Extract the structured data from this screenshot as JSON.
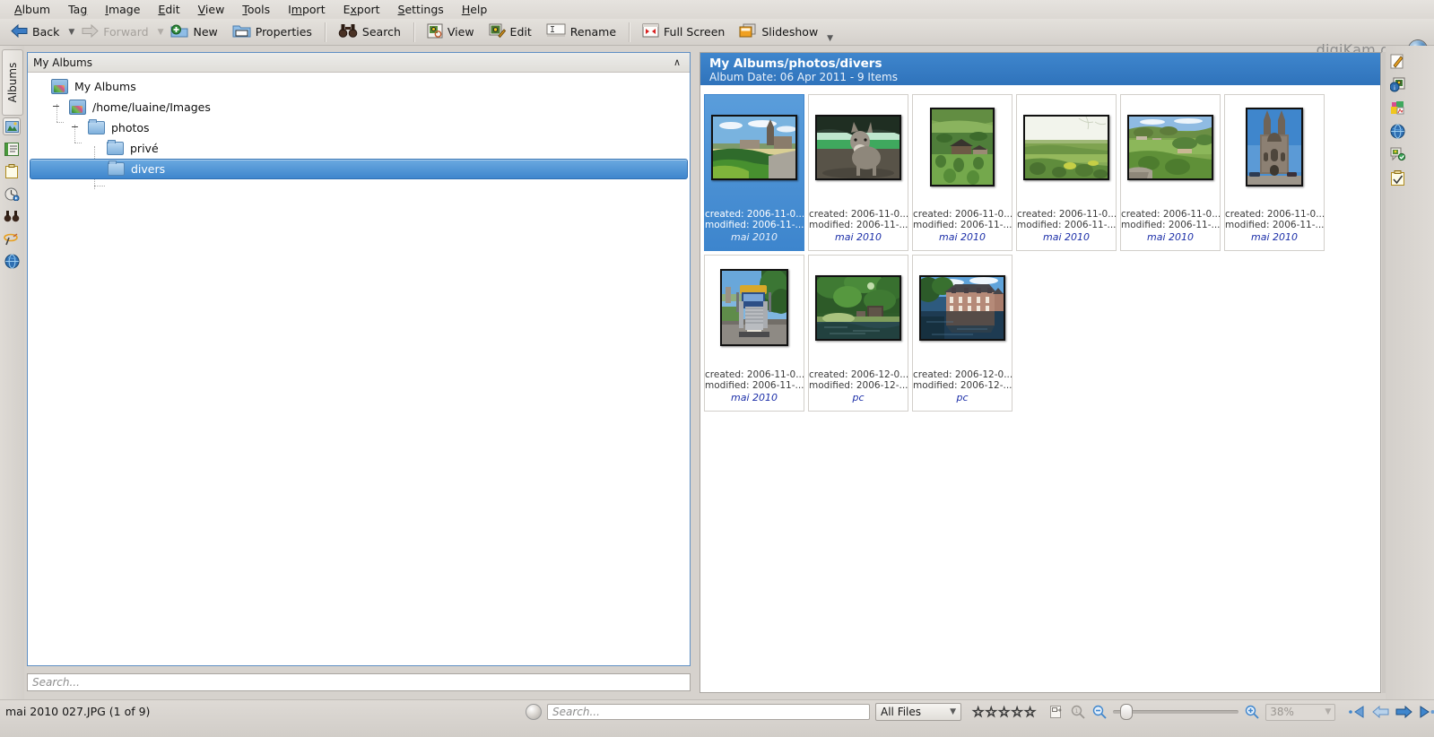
{
  "menubar": {
    "items": [
      {
        "label": "Album",
        "accel": "A"
      },
      {
        "label": "Tag",
        "accel": "g"
      },
      {
        "label": "Image",
        "accel": "I"
      },
      {
        "label": "Edit",
        "accel": "E"
      },
      {
        "label": "View",
        "accel": "V"
      },
      {
        "label": "Tools",
        "accel": "T"
      },
      {
        "label": "Import",
        "accel": "m"
      },
      {
        "label": "Export",
        "accel": "x"
      },
      {
        "label": "Settings",
        "accel": "S"
      },
      {
        "label": "Help",
        "accel": "H"
      }
    ]
  },
  "toolbar": {
    "back_label": "Back",
    "forward_label": "Forward",
    "new_label": "New",
    "properties_label": "Properties",
    "search_label": "Search",
    "view_label": "View",
    "edit_label": "Edit",
    "rename_label": "Rename",
    "fullscreen_label": "Full Screen",
    "slideshow_label": "Slideshow",
    "brand_text": "digiKam.org"
  },
  "left_rail": {
    "active_tab_label": "Albums",
    "icons": [
      {
        "name": "albums-icon",
        "glyph": "🖼"
      },
      {
        "name": "tags-icon",
        "glyph": "📝"
      },
      {
        "name": "labels-icon",
        "glyph": "📋"
      },
      {
        "name": "timeline-icon",
        "glyph": "⏱"
      },
      {
        "name": "searches-icon",
        "glyph": "🔭"
      },
      {
        "name": "fuzzy-search-icon",
        "glyph": "✏"
      },
      {
        "name": "map-search-icon",
        "glyph": "🌐"
      }
    ]
  },
  "tree_panel": {
    "header_label": "My Albums",
    "collapse_glyph": "∧",
    "rows": [
      {
        "label": "My Albums",
        "icon": "album-root-icon",
        "indent": 0,
        "expander": "",
        "selected": false
      },
      {
        "label": "/home/luaine/Images",
        "icon": "album-root-icon",
        "indent": 1,
        "expander": "−",
        "selected": false
      },
      {
        "label": "photos",
        "icon": "folder-icon",
        "indent": 2,
        "expander": "−",
        "selected": false
      },
      {
        "label": "privé",
        "icon": "folder-icon",
        "indent": 3,
        "expander": "",
        "selected": false
      },
      {
        "label": "divers",
        "icon": "folder-icon",
        "indent": 3,
        "expander": "",
        "selected": true
      }
    ],
    "search_placeholder": "Search..."
  },
  "album_banner": {
    "title": "My Albums/photos/divers",
    "subtitle": "Album Date: 06 Apr 2011 - 9 Items"
  },
  "thumbnails": [
    {
      "created": "created: 2006-11-0...",
      "modified": "modified: 2006-11-...",
      "album": "mai 2010",
      "selected": true,
      "orientation": "landscape",
      "scene": "village-church"
    },
    {
      "created": "created: 2006-11-0...",
      "modified": "modified: 2006-11-...",
      "album": "mai 2010",
      "selected": false,
      "orientation": "landscape",
      "scene": "donkey"
    },
    {
      "created": "created: 2006-11-0...",
      "modified": "modified: 2006-11-...",
      "album": "mai 2010",
      "selected": false,
      "orientation": "portrait",
      "scene": "farm-hill"
    },
    {
      "created": "created: 2006-11-0...",
      "modified": "modified: 2006-11-...",
      "album": "mai 2010",
      "selected": false,
      "orientation": "landscape",
      "scene": "fields-sky"
    },
    {
      "created": "created: 2006-11-0...",
      "modified": "modified: 2006-11-...",
      "album": "mai 2010",
      "selected": false,
      "orientation": "landscape",
      "scene": "green-valley"
    },
    {
      "created": "created: 2006-11-0...",
      "modified": "modified: 2006-11-...",
      "album": "mai 2010",
      "selected": false,
      "orientation": "portrait",
      "scene": "cathedral"
    },
    {
      "created": "created: 2006-11-0...",
      "modified": "modified: 2006-11-...",
      "album": "mai 2010",
      "selected": false,
      "orientation": "portrait",
      "scene": "truck"
    },
    {
      "created": "created: 2006-12-0...",
      "modified": "modified: 2006-12-...",
      "album": "pc",
      "selected": false,
      "orientation": "landscape",
      "scene": "canal-lock"
    },
    {
      "created": "created: 2006-12-0...",
      "modified": "modified: 2006-12-...",
      "album": "pc",
      "selected": false,
      "orientation": "landscape",
      "scene": "manor-water"
    }
  ],
  "right_rail": {
    "icons": [
      {
        "name": "caption-edit-icon",
        "glyph": "✎"
      },
      {
        "name": "properties-info-icon",
        "glyph": "ℹ"
      },
      {
        "name": "colors-histogram-icon",
        "glyph": "🎨"
      },
      {
        "name": "geolocation-icon",
        "glyph": "🌐"
      },
      {
        "name": "comments-tags-icon",
        "glyph": "🏷"
      },
      {
        "name": "filters-icon",
        "glyph": "☑"
      }
    ]
  },
  "statusbar": {
    "current_file": "mai 2010 027.JPG (1 of 9)",
    "search_placeholder": "Search...",
    "filter_value": "All Files",
    "rating_stars": 5,
    "rating_value": 0,
    "zoom_percent": "38%",
    "zoom_slider_value": 10
  }
}
